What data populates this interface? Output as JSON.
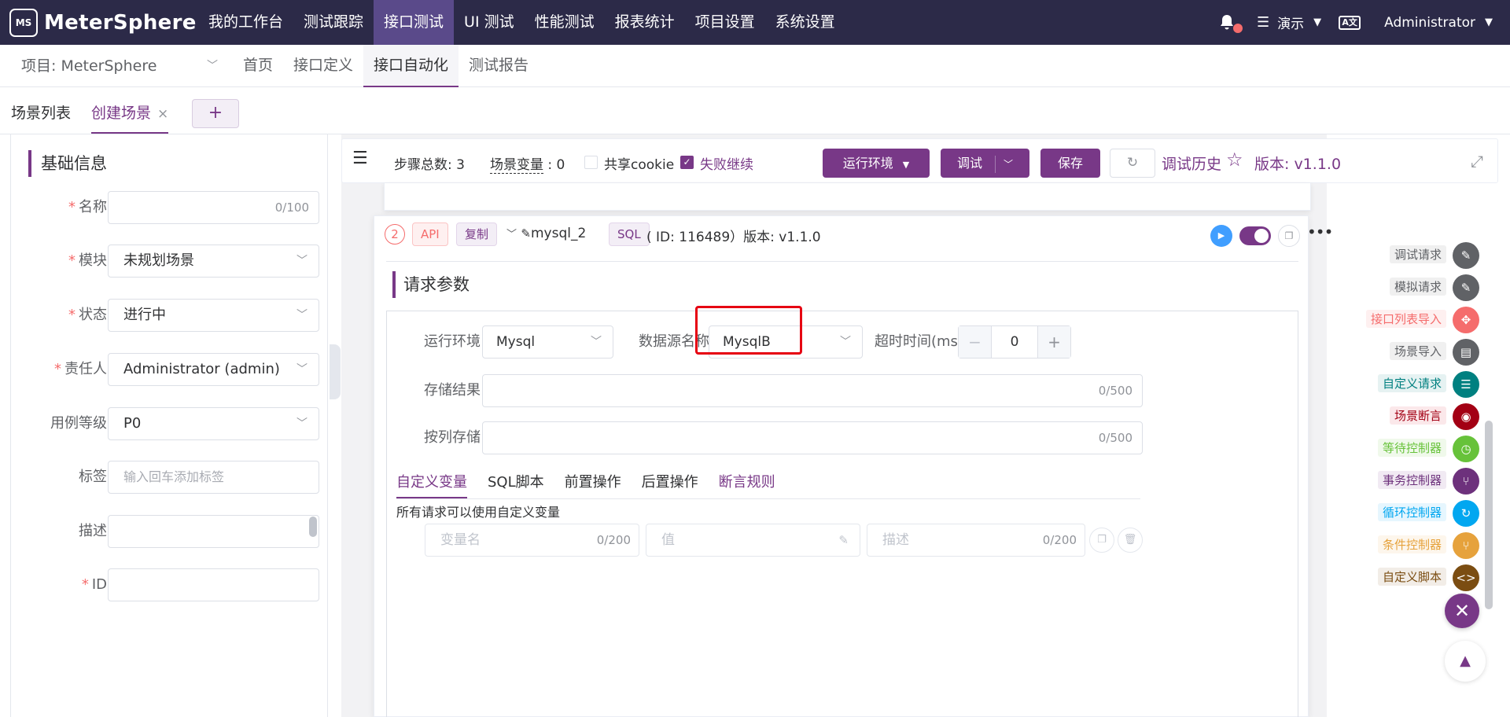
{
  "brand": {
    "name": "MeterSphere",
    "mark": "MS"
  },
  "topnav": {
    "items": [
      "我的工作台",
      "测试跟踪",
      "接口测试",
      "UI 测试",
      "性能测试",
      "报表统计",
      "项目设置",
      "系统设置"
    ],
    "active_index": 2,
    "workspace": "演示",
    "lang": "A文",
    "user": "Administrator"
  },
  "subnav": {
    "project": "项目: MeterSphere",
    "tabs": [
      "首页",
      "接口定义",
      "接口自动化",
      "测试报告"
    ],
    "active_index": 2
  },
  "tabs": {
    "list": "场景列表",
    "create": "创建场景",
    "close": "×",
    "add": "+"
  },
  "basic": {
    "title": "基础信息",
    "name_label": "名称",
    "name_count": "0/100",
    "module_label": "模块",
    "module_value": "未规划场景",
    "status_label": "状态",
    "status_value": "进行中",
    "owner_label": "责任人",
    "owner_value": "Administrator (admin)",
    "level_label": "用例等级",
    "level_value": "P0",
    "tag_label": "标签",
    "tag_placeholder": "输入回车添加标签",
    "desc_label": "描述",
    "id_label": "ID"
  },
  "toolbar": {
    "steps_label": "步骤总数:",
    "steps_count": "3",
    "vars_label": "场景变量",
    "vars_count": "0",
    "share_cookie": "共享cookie",
    "continue_on_fail": "失败继续",
    "env_button": "运行环境",
    "debug_button": "调试",
    "save_button": "保存",
    "history": "调试历史",
    "version": "版本: v1.1.0"
  },
  "step": {
    "index": "2",
    "type": "API",
    "copy": "复制",
    "name": "mysql_2",
    "protocol": "SQL",
    "id_text": "( ID: 116489）版本: v1.1.0"
  },
  "request": {
    "title": "请求参数",
    "env_label": "运行环境",
    "env_value": "Mysql",
    "ds_label": "数据源名称",
    "ds_value": "MysqlB",
    "timeout_label": "超时时间(ms)",
    "timeout_value": "0",
    "store_label": "存储结果",
    "store_count": "0/500",
    "col_label": "按列存储",
    "col_count": "0/500",
    "tabs": [
      "自定义变量",
      "SQL脚本",
      "前置操作",
      "后置操作",
      "断言规则"
    ],
    "hint": "所有请求可以使用自定义变量",
    "var_name_ph": "变量名",
    "var_name_count": "0/200",
    "value_ph": "值",
    "desc_ph": "描述",
    "desc_count": "0/200"
  },
  "side_actions": [
    {
      "label": "调试请求",
      "color": "#606266",
      "bg": "#f0f0f0",
      "icon_bg": "#606266"
    },
    {
      "label": "模拟请求",
      "color": "#606266",
      "bg": "#f0f0f0",
      "icon_bg": "#606266"
    },
    {
      "label": "接口列表导入",
      "color": "#f56c6c",
      "bg": "#fef0f0",
      "icon_bg": "#f56c6c"
    },
    {
      "label": "场景导入",
      "color": "#606266",
      "bg": "#f0f0f0",
      "icon_bg": "#606266"
    },
    {
      "label": "自定义请求",
      "color": "#008080",
      "bg": "#e6f2f2",
      "icon_bg": "#008080"
    },
    {
      "label": "场景断言",
      "color": "#a30014",
      "bg": "#fbe8ea",
      "icon_bg": "#a30014"
    },
    {
      "label": "等待控制器",
      "color": "#67c23a",
      "bg": "#f0f9eb",
      "icon_bg": "#67c23a"
    },
    {
      "label": "事务控制器",
      "color": "#6d317c",
      "bg": "#f1eaf3",
      "icon_bg": "#6d317c"
    },
    {
      "label": "循环控制器",
      "color": "#02a7f0",
      "bg": "#e6f6fe",
      "icon_bg": "#02a7f0"
    },
    {
      "label": "条件控制器",
      "color": "#e6a23c",
      "bg": "#fdf6ec",
      "icon_bg": "#e6a23c"
    },
    {
      "label": "自定义脚本",
      "color": "#7b4d12",
      "bg": "#f2ede7",
      "icon_bg": "#7b4d12"
    }
  ]
}
